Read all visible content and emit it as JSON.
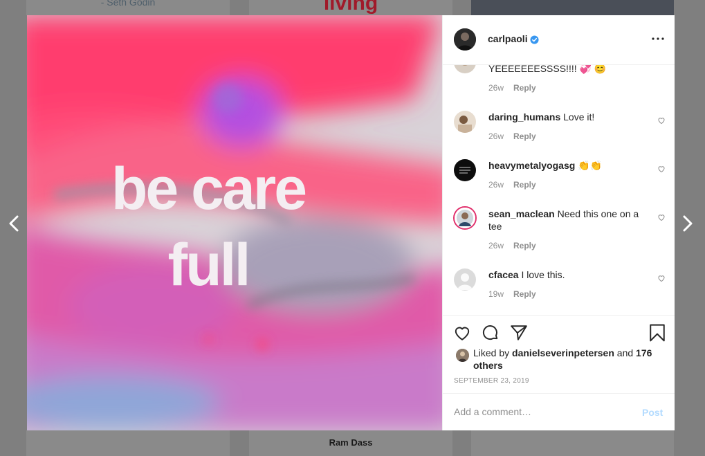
{
  "background_tiles": {
    "left_caption": "- Seth Godin",
    "mid_caption": "living",
    "bottom_mid_caption": "Ram Dass"
  },
  "post": {
    "quote_line_1": "be care",
    "quote_line_2": "full"
  },
  "owner": {
    "username": "carlpaoli",
    "verified": true
  },
  "comments": [
    {
      "username": "",
      "text": "YEEEEEEESSSS!!!! 💞 😊",
      "age": "26w",
      "reply_label": "Reply"
    },
    {
      "username": "daring_humans",
      "text": "Love it!",
      "age": "26w",
      "reply_label": "Reply"
    },
    {
      "username": "heavymetalyogasg",
      "text": "👏👏",
      "age": "26w",
      "reply_label": "Reply"
    },
    {
      "username": "sean_maclean",
      "text": "Need this one on a tee",
      "age": "26w",
      "reply_label": "Reply"
    },
    {
      "username": "cfacea",
      "text": "I love this.",
      "age": "19w",
      "reply_label": "Reply"
    }
  ],
  "likes": {
    "prefix": "Liked by",
    "user": "danielseverinpetersen",
    "and": "and",
    "others": "176 others"
  },
  "date": "SEPTEMBER 23, 2019",
  "add_comment": {
    "placeholder": "Add a comment…",
    "post_label": "Post"
  },
  "colors": {
    "accent": "#0095f6",
    "verified": "#3897f0",
    "post_disabled": "#b3dbff"
  },
  "icons": {
    "prev": "chevron-left-icon",
    "next": "chevron-right-icon",
    "more": "more-horizontal-icon",
    "like": "heart-icon",
    "comment": "comment-bubble-icon",
    "share": "paper-plane-icon",
    "save": "bookmark-icon"
  }
}
